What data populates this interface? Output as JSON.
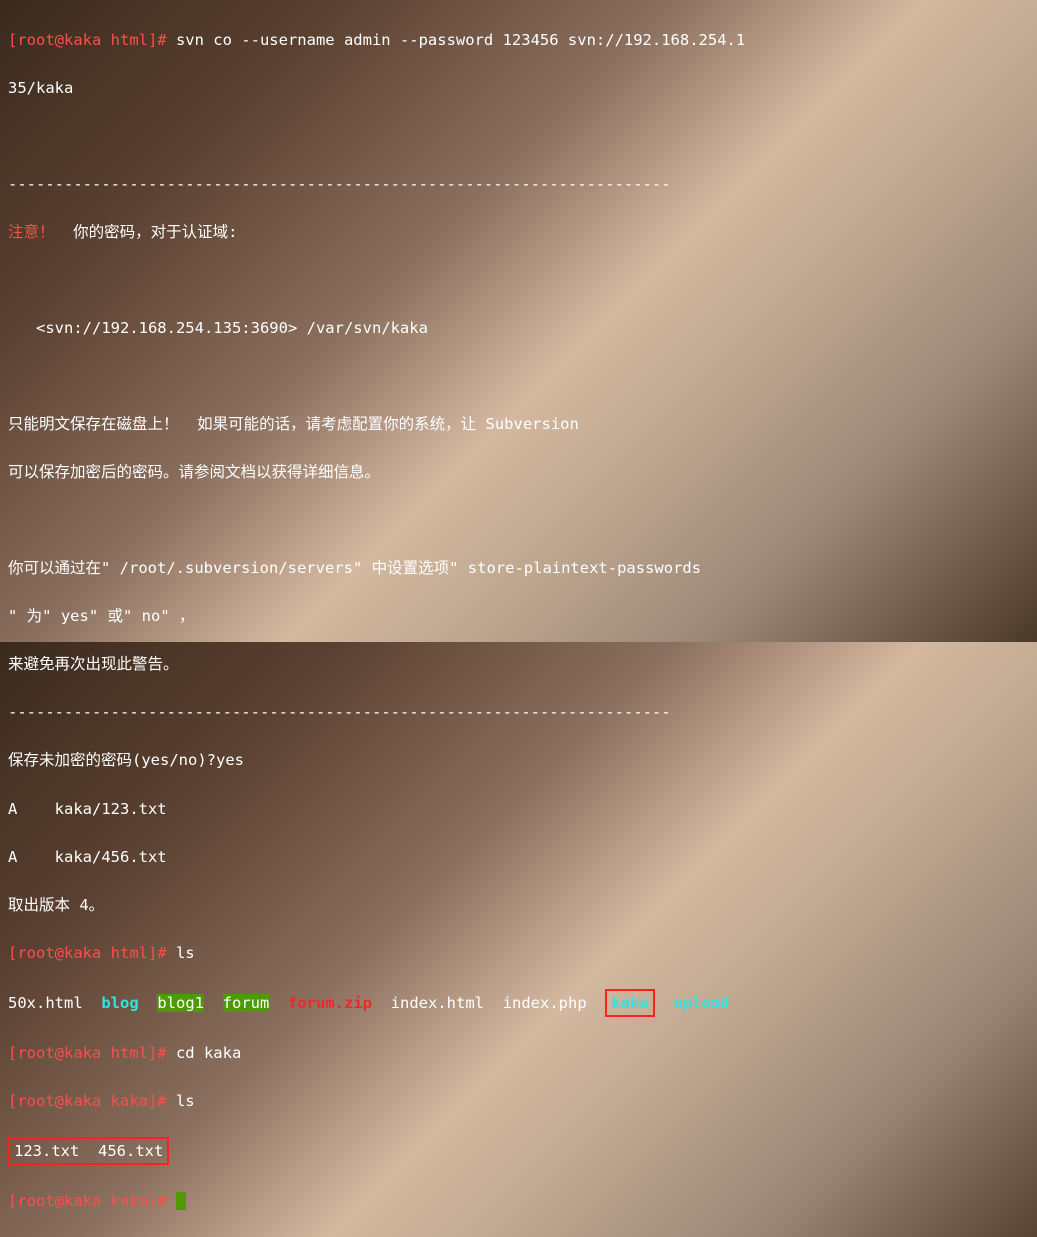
{
  "prompt1": {
    "userhost": "[root@kaka html]#",
    "cmd": " svn co --username admin --password 123456 svn://192.168.254.1"
  },
  "prompt1b": "35/kaka",
  "dash_line": "-----------------------------------------------------------------------",
  "attn": "注意！",
  "attn_rest": "  你的密码，对于认证域:",
  "realm": "   <svn://192.168.254.135:3690> /var/svn/kaka",
  "warn1": "只能明文保存在磁盘上！  如果可能的话，请考虑配置你的系统，让 Subversion",
  "warn2": "可以保存加密后的密码。请参阅文档以获得详细信息。",
  "warn3": "你可以通过在\" /root/.subversion/servers\" 中设置选项\" store-plaintext-passwords",
  "warn4": "\" 为\" yes\" 或\" no\" ，",
  "warn5": "来避免再次出现此警告。",
  "save_prompt": "保存未加密的密码(yes/no)?yes",
  "a1": "A    kaka/123.txt",
  "a2": "A    kaka/456.txt",
  "revision": "取出版本 4。",
  "ls1": {
    "prompt": "[root@kaka html]#",
    "cmd": " ls"
  },
  "listing": {
    "f1": "50x.html",
    "f2": "blog",
    "f3": "blog1",
    "f4": "forum",
    "f5": "forum.zip",
    "f6": "index.html",
    "f7": "index.php",
    "f8": "kaka",
    "f9": "upload"
  },
  "cd": {
    "prompt": "[root@kaka html]#",
    "cmd": " cd kaka"
  },
  "ls2": {
    "prompt": "[root@kaka kaka]#",
    "cmd": " ls"
  },
  "files": "123.txt  456.txt",
  "final": {
    "prompt": "[root@kaka kaka]#"
  }
}
